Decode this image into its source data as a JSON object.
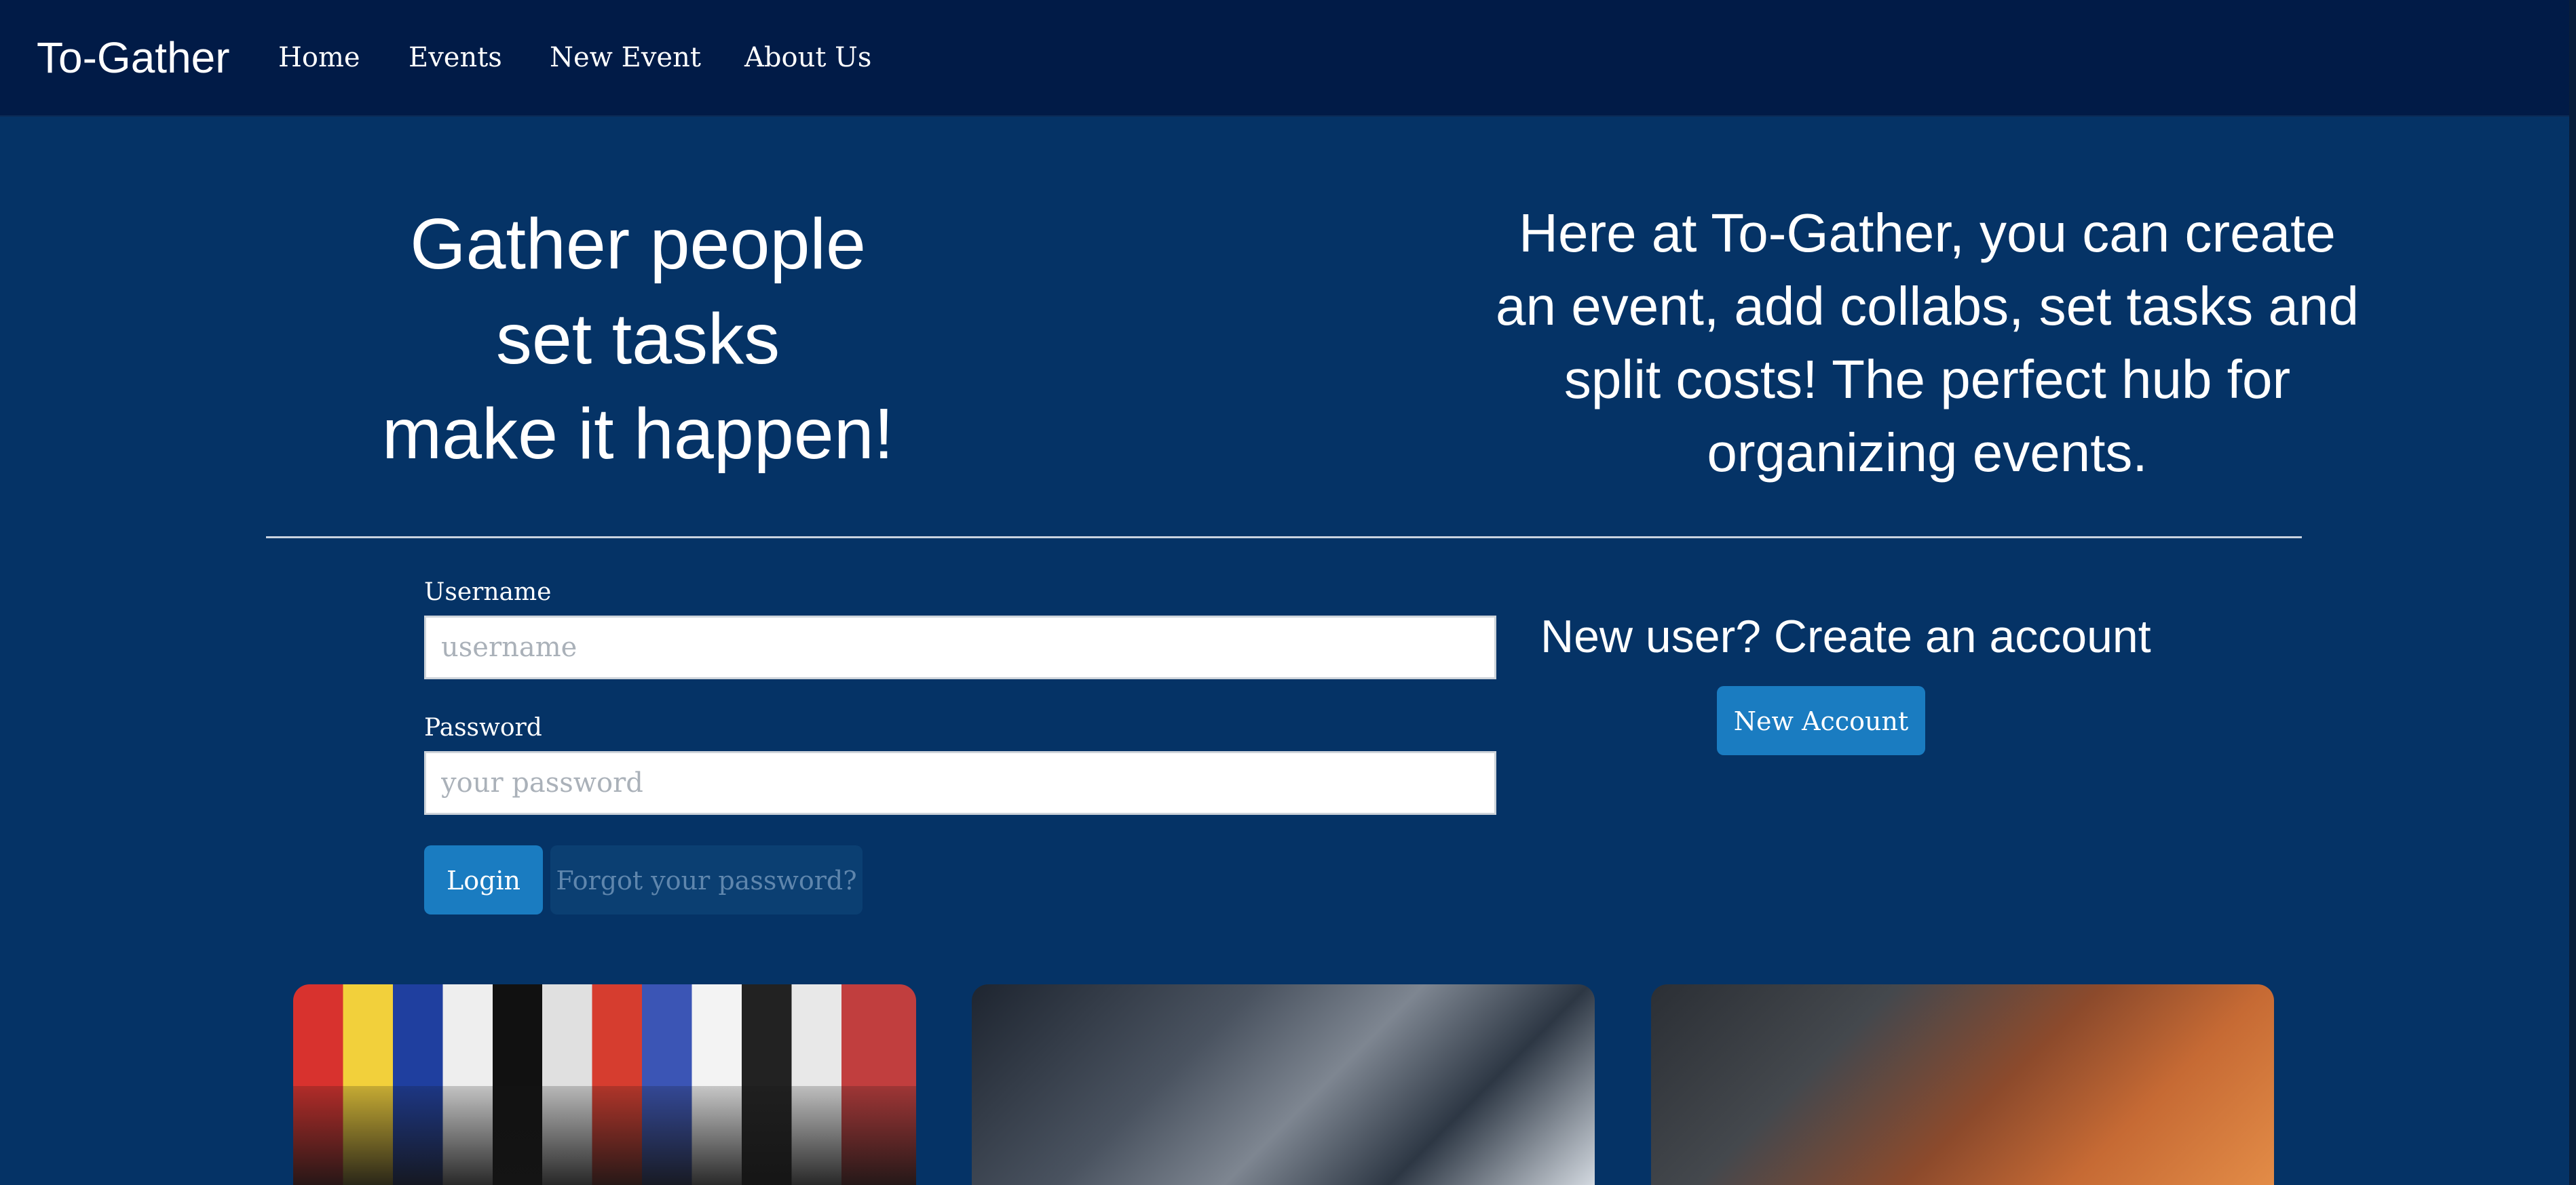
{
  "nav": {
    "brand": "To-Gather",
    "links": [
      "Home",
      "Events",
      "New Event",
      "About Us"
    ]
  },
  "hero": {
    "left_lines": [
      "Gather people",
      "set tasks",
      "make it happen!"
    ],
    "right_text": "Here at To-Gather, you can create an event, add collabs, set tasks and split costs! The perfect hub for organizing events."
  },
  "login": {
    "username_label": "Username",
    "username_placeholder": "username",
    "password_label": "Password",
    "password_placeholder": "your password",
    "login_button": "Login",
    "forgot_button": "Forgot your password?"
  },
  "signup": {
    "prompt": "New user? Create an account",
    "button": "New Account"
  },
  "colors": {
    "navbar": "#011b47",
    "background": "#053366",
    "primary_button": "#1a7cc1"
  }
}
